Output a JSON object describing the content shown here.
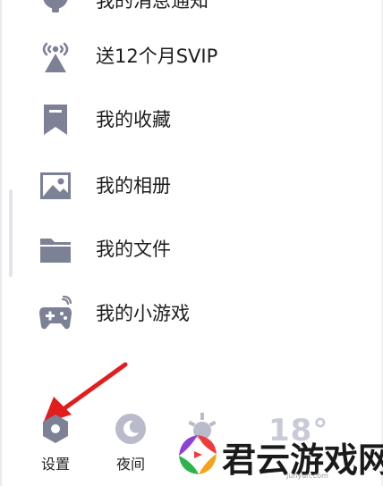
{
  "menu": {
    "items": [
      {
        "id": "partial-top",
        "label": "我的消息通知",
        "icon": "bell-icon"
      },
      {
        "id": "svip",
        "label": "送12个月SVIP",
        "icon": "broadcast-tower-icon"
      },
      {
        "id": "favorites",
        "label": "我的收藏",
        "icon": "bookmark-icon"
      },
      {
        "id": "album",
        "label": "我的相册",
        "icon": "image-icon"
      },
      {
        "id": "files",
        "label": "我的文件",
        "icon": "folder-icon"
      },
      {
        "id": "games",
        "label": "我的小游戏",
        "icon": "gamepad-icon"
      }
    ]
  },
  "dock": {
    "settings_label": "设置",
    "night_label": "夜间",
    "temperature": "18°"
  },
  "watermark": {
    "text": "君云游戏网",
    "sub": "junyun.com"
  },
  "colors": {
    "icon": "#7d8195",
    "dock_icon": "#b9bbca",
    "arrow": "#e11d1d"
  }
}
